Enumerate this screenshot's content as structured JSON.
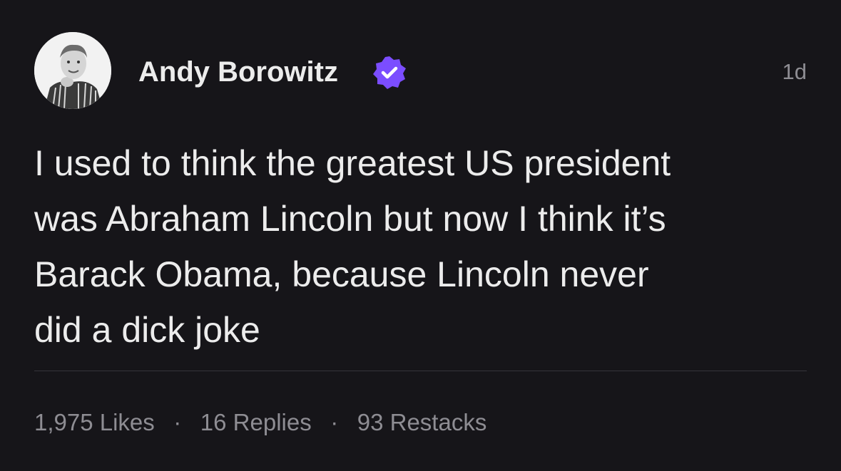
{
  "author": {
    "name": "Andy Borowitz",
    "verified": true,
    "avatar": "profile-photo"
  },
  "timestamp": "1d",
  "body": "I used to think the greatest US president\nwas Abraham Lincoln but now I think it’s\nBarack Obama, because Lincoln never\ndid a dick joke",
  "stats": {
    "likes": "1,975 Likes",
    "replies": "16 Replies",
    "restacks": "93 Restacks",
    "separator": "·"
  },
  "colors": {
    "background": "#161519",
    "text": "#ececec",
    "muted": "#8e8d93",
    "verified_badge": "#7b4dff"
  }
}
